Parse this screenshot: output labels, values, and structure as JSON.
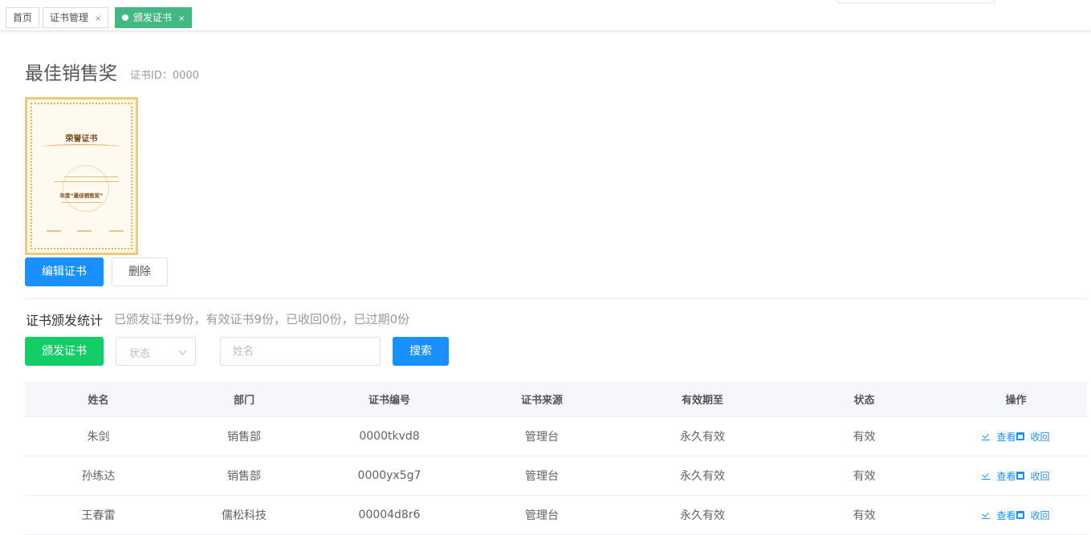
{
  "tabs": [
    {
      "label": "首页",
      "closable": false,
      "active": false
    },
    {
      "label": "证书管理",
      "closable": true,
      "active": false
    },
    {
      "label": "颁发证书",
      "closable": true,
      "active": true
    }
  ],
  "tab_close_glyph": "×",
  "header": {
    "title": "最佳销售奖",
    "cert_id": "证书ID：0000"
  },
  "certificate_image": {
    "title": "荣誉证书",
    "award": "年度“最佳销售奖”"
  },
  "actions": {
    "edit": "编辑证书",
    "delete": "删除"
  },
  "stats": {
    "label": "证书颁发统计",
    "summary": "已颁发证书9份，有效证书9份，已收回0份，已过期0份"
  },
  "toolbar": {
    "issue": "颁发证书",
    "status_placeholder": "状态",
    "name_placeholder": "姓名",
    "search": "搜索"
  },
  "table": {
    "columns": [
      "姓名",
      "部门",
      "证书编号",
      "证书来源",
      "有效期至",
      "状态",
      "操作"
    ],
    "rows": [
      {
        "name": "朱剑",
        "dept": "销售部",
        "code": "0000tkvd8",
        "source": "管理台",
        "expiry": "永久有效",
        "status": "有效",
        "view": "查看",
        "revoke": "收回"
      },
      {
        "name": "孙练达",
        "dept": "销售部",
        "code": "0000yx5g7",
        "source": "管理台",
        "expiry": "永久有效",
        "status": "有效",
        "view": "查看",
        "revoke": "收回"
      },
      {
        "name": "王春雷",
        "dept": "儒松科技",
        "code": "00004d8r6",
        "source": "管理台",
        "expiry": "永久有效",
        "status": "有效",
        "view": "查看",
        "revoke": "收回"
      }
    ]
  },
  "colors": {
    "primary": "#1890ff",
    "success": "#13ce66",
    "active_tab": "#42b983"
  }
}
